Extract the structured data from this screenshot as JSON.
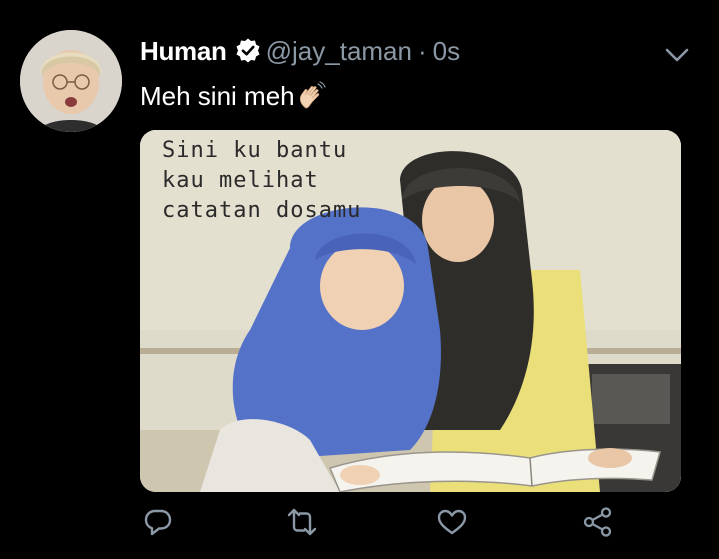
{
  "tweet": {
    "display_name": "Human",
    "handle": "@jay_taman",
    "separator": "·",
    "time": "0s",
    "text": "Meh sini meh",
    "emoji": "waving-hand"
  },
  "media": {
    "caption_lines": [
      "Sini ku bantu",
      "kau melihat",
      "catatan dosamu"
    ]
  },
  "actions": {
    "icons": [
      "reply-icon",
      "retweet-icon",
      "like-icon",
      "share-icon"
    ]
  },
  "colors": {
    "background": "#000000",
    "text_primary": "#ffffff",
    "text_secondary": "#8b98a5",
    "verified": "#ffffff",
    "icon": "#8b98a5"
  }
}
